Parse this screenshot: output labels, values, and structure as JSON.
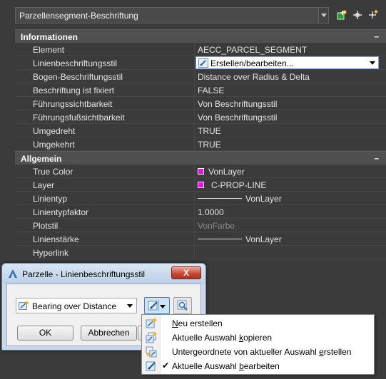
{
  "header": {
    "object_selector": "Parzellensegment-Beschriftung"
  },
  "sections": [
    {
      "title": "Informationen",
      "collapse": "–",
      "rows": [
        {
          "key": "Element",
          "value": "AECC_PARCEL_SEGMENT"
        },
        {
          "key": "Linienbeschriftungsstil",
          "value": "Erstellen/bearbeiten..."
        },
        {
          "key": "Bogen-Beschriftungsstil",
          "value": "Distance over Radius & Delta"
        },
        {
          "key": "Beschriftung ist fixiert",
          "value": "FALSE"
        },
        {
          "key": "Führungssichtbarkeit",
          "value": "Von Beschriftungsstil"
        },
        {
          "key": "Führungsfußsichtbarkeit",
          "value": "Von Beschriftungsstil"
        },
        {
          "key": "Umgedreht",
          "value": "TRUE"
        },
        {
          "key": "Umgekehrt",
          "value": "TRUE"
        }
      ]
    },
    {
      "title": "Allgemein",
      "collapse": "–",
      "rows": [
        {
          "key": "True Color",
          "value": "VonLayer"
        },
        {
          "key": "Layer",
          "value": "C-PROP-LINE"
        },
        {
          "key": "Linientyp",
          "value": "VonLayer"
        },
        {
          "key": "Linientypfaktor",
          "value": "1.0000"
        },
        {
          "key": "Plotstil",
          "value": "VonFarbe"
        },
        {
          "key": "Linienstärke",
          "value": "VonLayer"
        },
        {
          "key": "Hyperlink",
          "value": ""
        }
      ]
    }
  ],
  "dialog": {
    "title": "Parzelle - Linienbeschriftungsstil",
    "close_label": "X",
    "style_select": "Bearing over Distance",
    "ok_label": "OK",
    "cancel_label": "Abbrechen"
  },
  "menu": {
    "items": [
      {
        "label": "Neu erstellen",
        "underline": "N",
        "rest": "eu erstellen",
        "checked": false
      },
      {
        "label": "Aktuelle Auswahl kopieren",
        "pre": "Aktuelle Auswahl ",
        "underline": "k",
        "rest": "opieren",
        "checked": false
      },
      {
        "label": "Untergeordnete von aktueller Auswahl erstellen",
        "pre": "Untergeordnete von aktueller Auswahl ",
        "underline": "e",
        "rest": "rstellen",
        "checked": false
      },
      {
        "label": "Aktuelle Auswahl bearbeiten",
        "pre": "Aktuelle Auswahl ",
        "underline": "b",
        "rest": "earbeiten",
        "checked": true,
        "check_glyph": "✔"
      }
    ]
  },
  "colors": {
    "panel_bg": "#3b3b3b",
    "category_bg": "#505050",
    "swatch": "#ff00ff",
    "dialog_frame": "#c9d8ea",
    "close_red": "#c7432f"
  },
  "icons": {
    "toolbar": [
      "quick-select-icon",
      "select-objects-icon",
      "toggle-pickadd-icon"
    ],
    "dialog_title": "autocad-a-icon",
    "menu": [
      "new-style-icon",
      "copy-style-icon",
      "child-style-icon",
      "edit-style-icon"
    ]
  }
}
